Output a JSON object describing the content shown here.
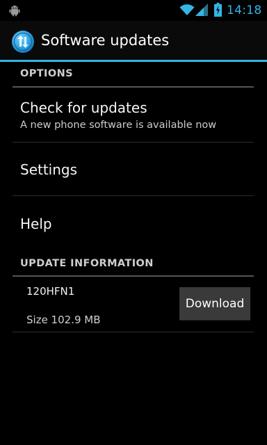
{
  "status_bar": {
    "time": "14:18",
    "icons": [
      "android-debug-icon",
      "wifi-icon",
      "signal-icon",
      "battery-charging-icon"
    ],
    "accent": "#33b5e5"
  },
  "action_bar": {
    "title": "Software updates",
    "icon": "software-update-logo-icon"
  },
  "options": {
    "header": "OPTIONS",
    "items": [
      {
        "title": "Check for updates",
        "summary": "A new phone software is available now"
      },
      {
        "title": "Settings"
      },
      {
        "title": "Help"
      }
    ]
  },
  "update_information": {
    "header": "UPDATE INFORMATION",
    "name": "120HFN1",
    "size": "Size 102.9 MB",
    "download_label": "Download"
  }
}
